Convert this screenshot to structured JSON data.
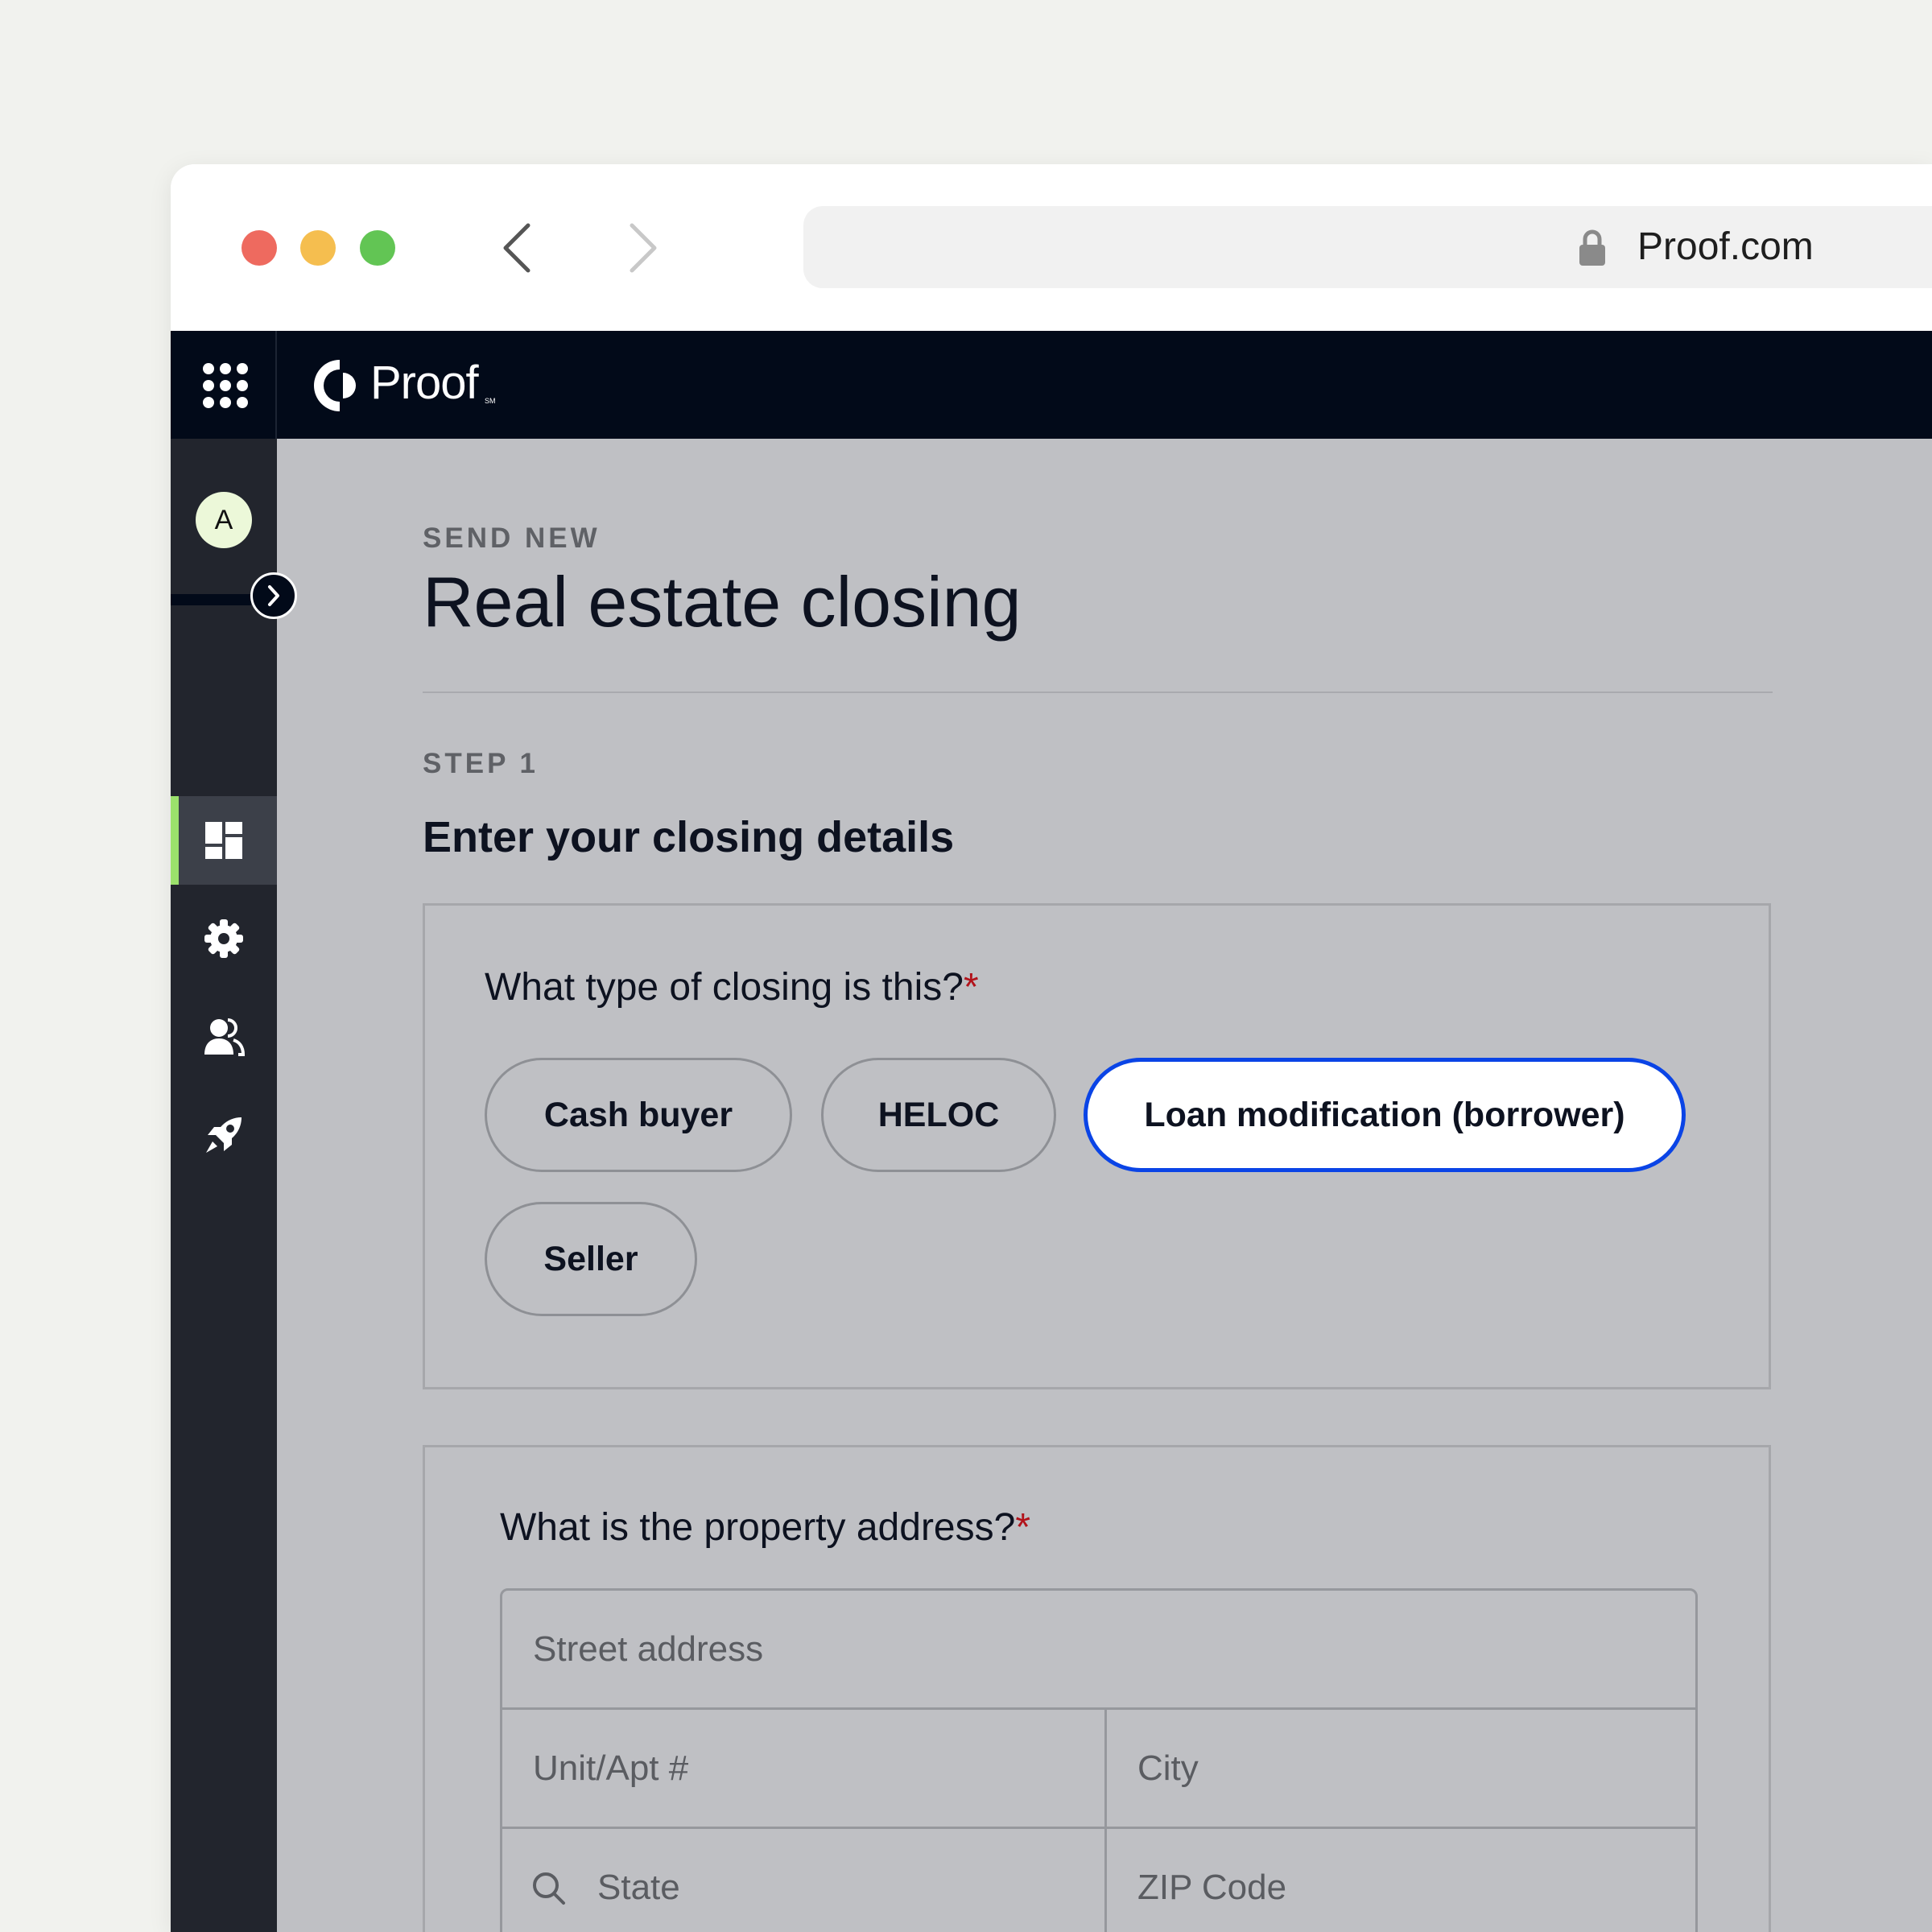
{
  "browser": {
    "url": "Proof.com",
    "icons": {
      "back": "chevron-left-icon",
      "forward": "chevron-right-icon",
      "lock": "lock-icon"
    }
  },
  "app": {
    "logo_text": "Proof",
    "logo_mark": "SM",
    "colors": {
      "topbar": "#020a19",
      "sidebar": "#22252d",
      "accent": "#9be16c",
      "selected": "#0a44e6",
      "required": "#b2131b"
    }
  },
  "sidebar": {
    "avatar_initial": "A",
    "items": [
      {
        "icon": "dashboard-icon",
        "active": true
      },
      {
        "icon": "gear-icon",
        "active": false
      },
      {
        "icon": "users-icon",
        "active": false
      },
      {
        "icon": "rocket-icon",
        "active": false
      }
    ]
  },
  "page": {
    "eyebrow": "SEND NEW",
    "title": "Real estate closing",
    "step_label": "STEP 1",
    "step_title": "Enter your closing details"
  },
  "closing_type": {
    "question": "What type of closing is this?",
    "required_mark": "*",
    "options": [
      {
        "label": "Cash buyer",
        "selected": false
      },
      {
        "label": "HELOC",
        "selected": false
      },
      {
        "label": "Loan modification (borrower)",
        "selected": true
      },
      {
        "label": "Seller",
        "selected": false
      }
    ]
  },
  "address": {
    "question": "What is the property address?",
    "required_mark": "*",
    "street_placeholder": "Street address",
    "unit_placeholder": "Unit/Apt #",
    "city_placeholder": "City",
    "state_placeholder": "State",
    "zip_placeholder": "ZIP Code"
  }
}
